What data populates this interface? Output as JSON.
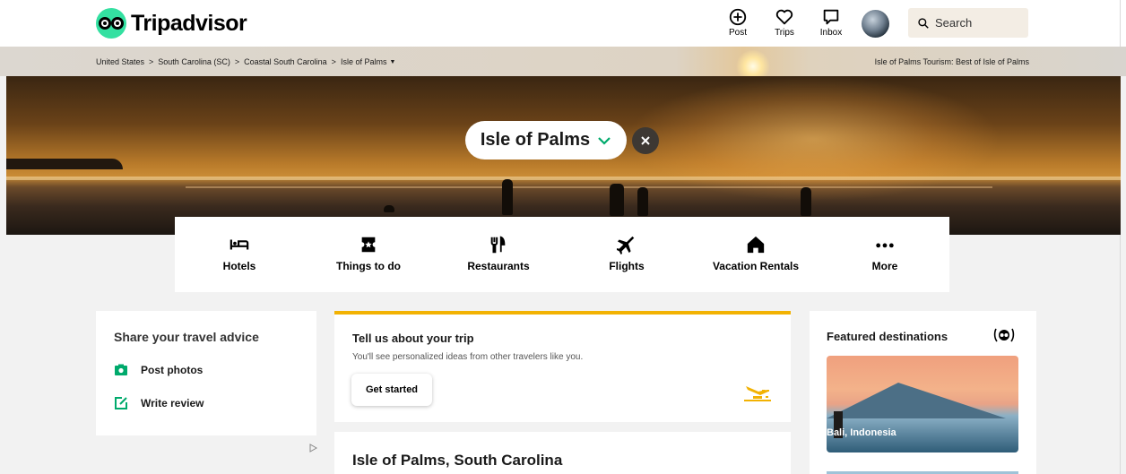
{
  "header": {
    "brand": "Tripadvisor",
    "nav": [
      {
        "label": "Post",
        "icon": "plus-circle-icon"
      },
      {
        "label": "Trips",
        "icon": "heart-icon"
      },
      {
        "label": "Inbox",
        "icon": "message-icon"
      }
    ],
    "search_label": "Search"
  },
  "breadcrumb": {
    "items": [
      "United States",
      "South Carolina (SC)",
      "Coastal South Carolina",
      "Isle of Palms"
    ],
    "right_text": "Isle of Palms Tourism: Best of Isle of Palms"
  },
  "hero": {
    "destination": "Isle of Palms"
  },
  "categories": [
    {
      "label": "Hotels",
      "icon": "bed-icon"
    },
    {
      "label": "Things to do",
      "icon": "ticket-icon"
    },
    {
      "label": "Restaurants",
      "icon": "fork-knife-icon"
    },
    {
      "label": "Flights",
      "icon": "airplane-icon"
    },
    {
      "label": "Vacation Rentals",
      "icon": "house-icon"
    },
    {
      "label": "More",
      "icon": "more-dots-icon"
    }
  ],
  "share": {
    "title": "Share your travel advice",
    "actions": [
      {
        "label": "Post photos",
        "icon": "camera-icon"
      },
      {
        "label": "Write review",
        "icon": "edit-icon"
      }
    ]
  },
  "trip": {
    "title": "Tell us about your trip",
    "subtitle": "You'll see personalized ideas from other travelers like you.",
    "button": "Get started"
  },
  "place": {
    "title": "Isle of Palms, South Carolina"
  },
  "featured": {
    "title": "Featured destinations",
    "items": [
      {
        "label": "Bali, Indonesia"
      }
    ]
  },
  "colors": {
    "brand_green": "#34e0a1",
    "accent_yellow": "#f2b203",
    "icon_green": "#00aa6c"
  }
}
